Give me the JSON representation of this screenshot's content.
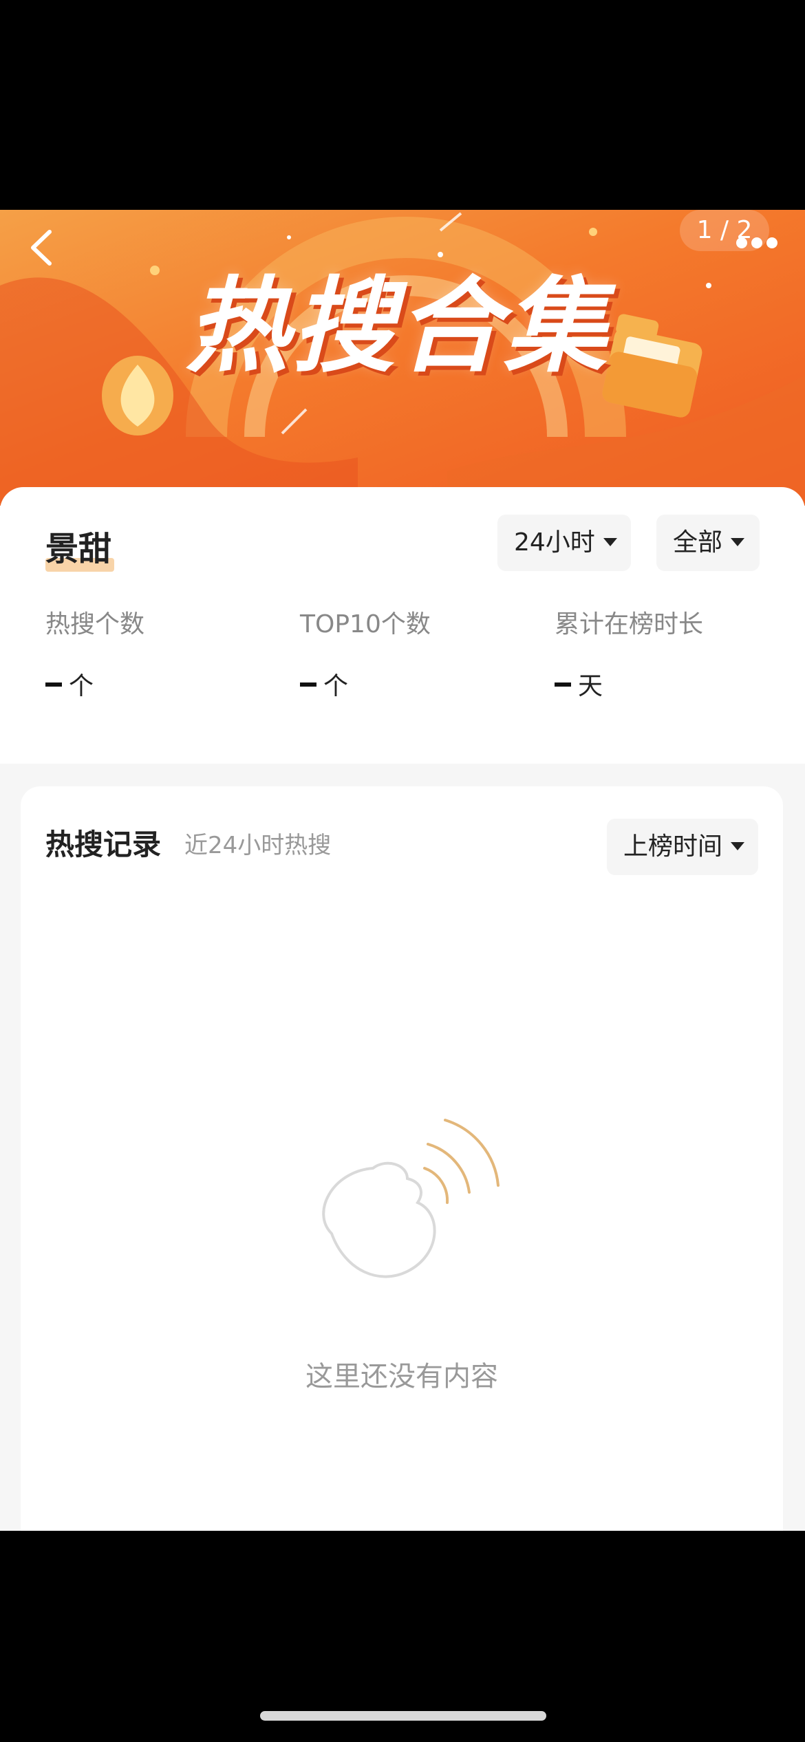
{
  "banner": {
    "title": "热搜合集",
    "page_counter": "1 / 2"
  },
  "icons": {
    "back": "chevron-left-icon",
    "more": "more-horizontal-icon",
    "dropdown": "caret-down-icon",
    "empty": "empty-state-icon"
  },
  "stats": {
    "name": "景甜",
    "time_filter": "24小时",
    "scope_filter": "全部",
    "items": [
      {
        "label": "热搜个数",
        "value": "-",
        "unit": "个"
      },
      {
        "label": "TOP10个数",
        "value": "-",
        "unit": "个"
      },
      {
        "label": "累计在榜时长",
        "value": "-",
        "unit": "天"
      }
    ]
  },
  "records": {
    "title": "热搜记录",
    "subtitle": "近24小时热搜",
    "sort_filter": "上榜时间",
    "empty_text": "这里还没有内容"
  },
  "colors": {
    "banner_start": "#f5a047",
    "banner_end": "#ef5a22",
    "accent": "#e9a24a",
    "highlight": "#f8d4a9"
  }
}
